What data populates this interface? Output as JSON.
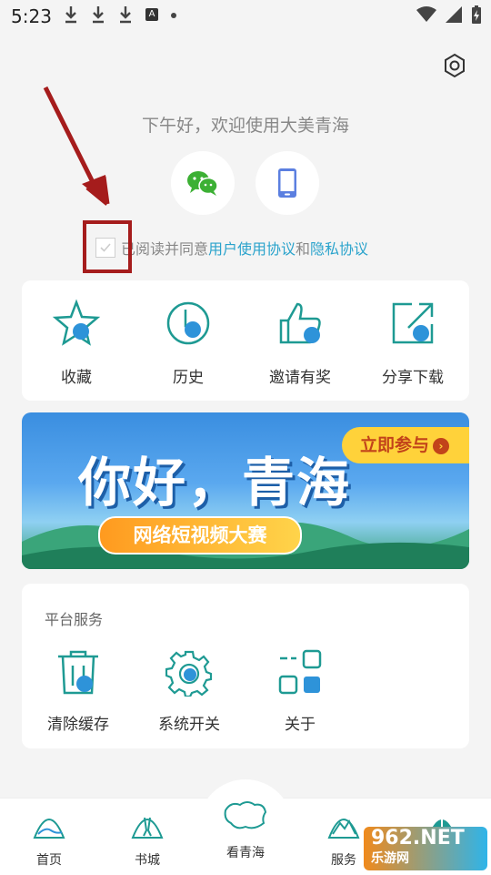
{
  "status_bar": {
    "time": "5:23",
    "a_badge": "A"
  },
  "greeting": "下午好，欢迎使用大美青海",
  "agreement": {
    "prefix": "已阅读并同意",
    "user_agreement": "用户使用协议",
    "and": "和",
    "privacy": "隐私协议"
  },
  "quick_actions": [
    {
      "label": "收藏",
      "icon": "star-icon"
    },
    {
      "label": "历史",
      "icon": "clock-icon"
    },
    {
      "label": "邀请有奖",
      "icon": "thumbs-up-icon"
    },
    {
      "label": "分享下载",
      "icon": "share-icon"
    }
  ],
  "banner": {
    "title": "你好，青海",
    "subtitle": "网络短视频大赛",
    "cta": "立即参与"
  },
  "services": {
    "title": "平台服务",
    "items": [
      {
        "label": "清除缓存",
        "icon": "trash-icon"
      },
      {
        "label": "系统开关",
        "icon": "gear-icon"
      },
      {
        "label": "关于",
        "icon": "grid-icon"
      }
    ]
  },
  "bottom_nav": [
    {
      "label": "首页"
    },
    {
      "label": "书城"
    },
    {
      "label": "看青海"
    },
    {
      "label": "服务"
    },
    {
      "label": ""
    }
  ],
  "watermark": {
    "main": "962.NET",
    "sub": "乐游网"
  },
  "colors": {
    "accent": "#2aa3cc",
    "teal": "#1e9a93",
    "annotation": "#a51c1c"
  }
}
